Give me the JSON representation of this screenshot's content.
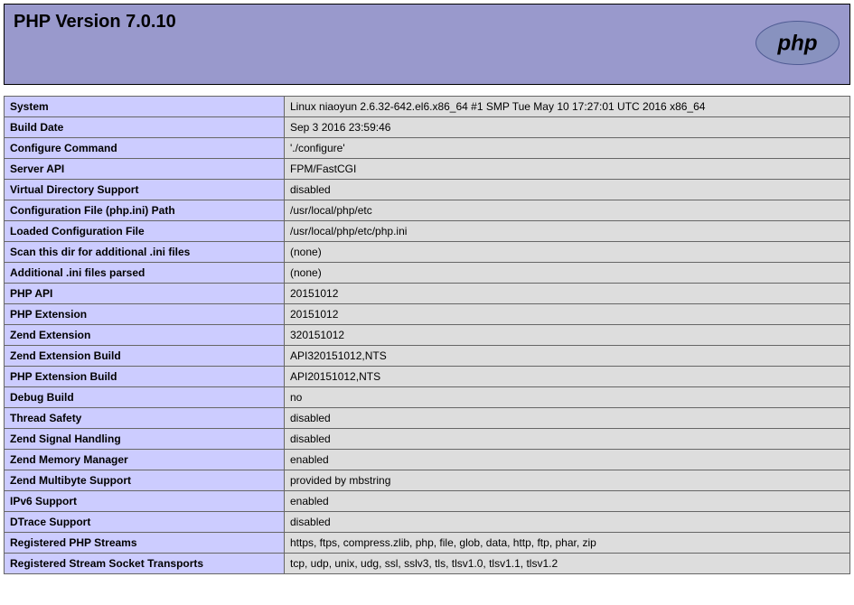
{
  "header": {
    "title": "PHP Version 7.0.10"
  },
  "rows": [
    {
      "label": "System",
      "value": "Linux niaoyun 2.6.32-642.el6.x86_64 #1 SMP Tue May 10 17:27:01 UTC 2016 x86_64"
    },
    {
      "label": "Build Date",
      "value": "Sep 3 2016 23:59:46"
    },
    {
      "label": "Configure Command",
      "value": "'./configure'"
    },
    {
      "label": "Server API",
      "value": "FPM/FastCGI"
    },
    {
      "label": "Virtual Directory Support",
      "value": "disabled"
    },
    {
      "label": "Configuration File (php.ini) Path",
      "value": "/usr/local/php/etc"
    },
    {
      "label": "Loaded Configuration File",
      "value": "/usr/local/php/etc/php.ini"
    },
    {
      "label": "Scan this dir for additional .ini files",
      "value": "(none)"
    },
    {
      "label": "Additional .ini files parsed",
      "value": "(none)"
    },
    {
      "label": "PHP API",
      "value": "20151012"
    },
    {
      "label": "PHP Extension",
      "value": "20151012"
    },
    {
      "label": "Zend Extension",
      "value": "320151012"
    },
    {
      "label": "Zend Extension Build",
      "value": "API320151012,NTS"
    },
    {
      "label": "PHP Extension Build",
      "value": "API20151012,NTS"
    },
    {
      "label": "Debug Build",
      "value": "no"
    },
    {
      "label": "Thread Safety",
      "value": "disabled"
    },
    {
      "label": "Zend Signal Handling",
      "value": "disabled"
    },
    {
      "label": "Zend Memory Manager",
      "value": "enabled"
    },
    {
      "label": "Zend Multibyte Support",
      "value": "provided by mbstring"
    },
    {
      "label": "IPv6 Support",
      "value": "enabled"
    },
    {
      "label": "DTrace Support",
      "value": "disabled"
    },
    {
      "label": "Registered PHP Streams",
      "value": "https, ftps, compress.zlib, php, file, glob, data, http, ftp, phar, zip"
    },
    {
      "label": "Registered Stream Socket Transports",
      "value": "tcp, udp, unix, udg, ssl, sslv3, tls, tlsv1.0, tlsv1.1, tlsv1.2"
    }
  ]
}
